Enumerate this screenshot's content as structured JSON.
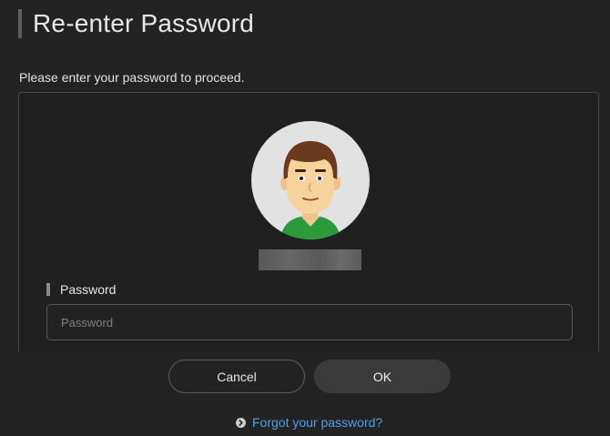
{
  "header": {
    "title": "Re-enter Password"
  },
  "instructions": "Please enter your password to proceed.",
  "account": {
    "avatar_icon": "mii-avatar-icon"
  },
  "password_field": {
    "label": "Password",
    "placeholder": "Password",
    "value": ""
  },
  "actions": {
    "cancel_label": "Cancel",
    "ok_label": "OK"
  },
  "forgot": {
    "label": "Forgot your password?",
    "icon": "chevron-right-circle-icon"
  },
  "colors": {
    "background": "#232323",
    "link": "#4e9ee9",
    "avatar_shirt": "#2a9a3b"
  }
}
